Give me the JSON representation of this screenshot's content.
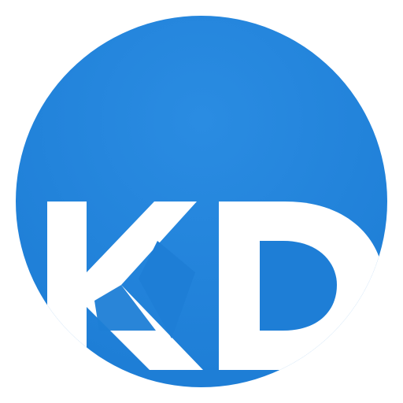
{
  "icon": {
    "semantic": "kd-logo-icon",
    "monogram": "KD",
    "colors": {
      "circle": "#1E7ED6",
      "circle_highlight": "#3A93E3",
      "letters": "#FFFFFF",
      "letter_edge": "#D7ECFF",
      "background": "#FFFFFF"
    }
  }
}
